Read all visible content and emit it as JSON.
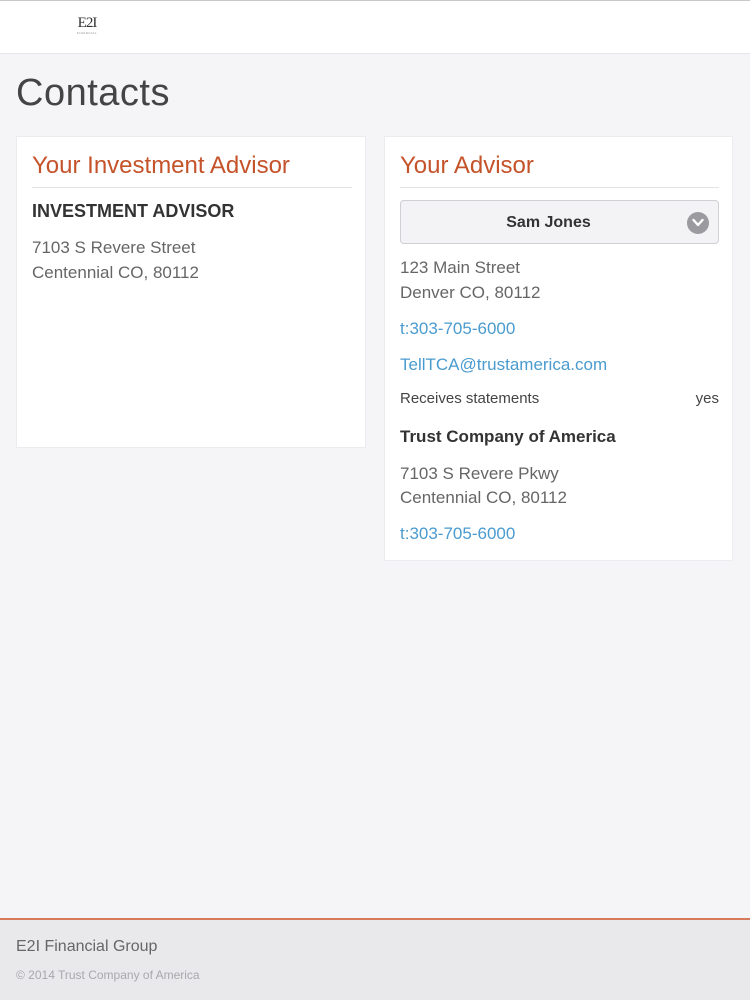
{
  "header": {
    "logo_text": "E2I",
    "logo_subtext": "FINANCIAL"
  },
  "page": {
    "title": "Contacts"
  },
  "investment_advisor_card": {
    "heading": "Your Investment Advisor",
    "name": "INVESTMENT ADVISOR",
    "address_line1": "7103 S Revere Street",
    "address_line2": "Centennial CO, 80112"
  },
  "advisor_card": {
    "heading": "Your Advisor",
    "selected_advisor": "Sam Jones",
    "address_line1": "123 Main Street",
    "address_line2": "Denver CO, 80112",
    "phone": "t:303-705-6000",
    "email": "TellTCA@trustamerica.com",
    "statements_label": "Receives statements",
    "statements_value": "yes",
    "company_name": "Trust Company of America",
    "company_address_line1": "7103 S Revere Pkwy",
    "company_address_line2": "Centennial CO, 80112",
    "company_phone": "t:303-705-6000"
  },
  "footer": {
    "company": "E2I Financial Group",
    "copyright": "© 2014 Trust Company of America"
  },
  "colors": {
    "accent": "#c5532a",
    "link": "#4a9bcf",
    "footer_rule": "#d57a5a"
  },
  "icons": {
    "select_chevron": "chevron-down-icon"
  }
}
